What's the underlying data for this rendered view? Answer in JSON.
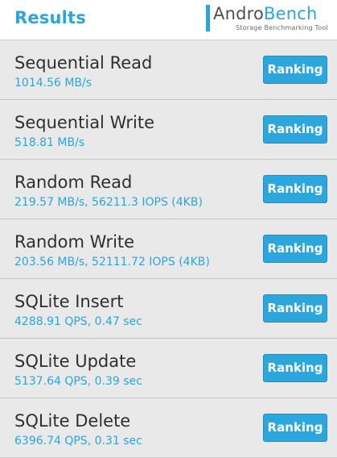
{
  "header": {
    "title": "Results",
    "logo": {
      "name_part1": "Andro",
      "name_part2": "Bench",
      "tagline": "Storage Benchmarking Tool"
    }
  },
  "results": [
    {
      "name": "Sequential Read",
      "value": "1014.56 MB/s",
      "button": "Ranking"
    },
    {
      "name": "Sequential Write",
      "value": "518.81 MB/s",
      "button": "Ranking"
    },
    {
      "name": "Random Read",
      "value": "219.57 MB/s, 56211.3 IOPS (4KB)",
      "button": "Ranking"
    },
    {
      "name": "Random Write",
      "value": "203.56 MB/s, 52111.72 IOPS (4KB)",
      "button": "Ranking"
    },
    {
      "name": "SQLite Insert",
      "value": "4288.91 QPS, 0.47 sec",
      "button": "Ranking"
    },
    {
      "name": "SQLite Update",
      "value": "5137.64 QPS, 0.39 sec",
      "button": "Ranking"
    },
    {
      "name": "SQLite Delete",
      "value": "6396.74 QPS, 0.31 sec",
      "button": "Ranking"
    }
  ],
  "colors": {
    "accent": "#2aa6dc",
    "background": "#e9e9e9",
    "header_bg": "#ffffff",
    "title_text": "#2f2f2f"
  }
}
